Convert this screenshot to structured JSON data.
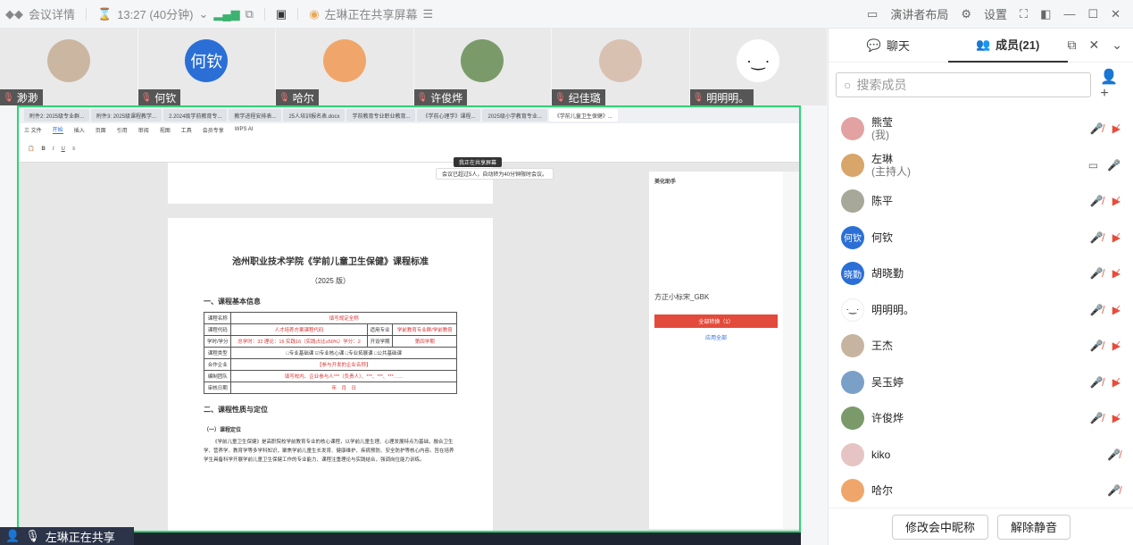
{
  "titlebar": {
    "meeting_details": "会议详情",
    "timer": "13:27 (40分钟)",
    "sharing_status": "左琳正在共享屏幕",
    "layout_label": "演讲者布局",
    "settings_label": "设置"
  },
  "video_tiles": [
    {
      "name": "渺渺",
      "avatar_text": "",
      "color": "#cbb7a1"
    },
    {
      "name": "何钦",
      "avatar_text": "何钦",
      "color": "#2b6fd6"
    },
    {
      "name": "哈尔",
      "avatar_text": "",
      "color": "#f0a66a"
    },
    {
      "name": "许俊烨",
      "avatar_text": "",
      "color": "#7a9a6a"
    },
    {
      "name": "纪佳璐",
      "avatar_text": "",
      "color": "#d9c1b2"
    },
    {
      "name": "明明明。",
      "avatar_text": "·‿·",
      "color": "#ffffff"
    }
  ],
  "shared_screen": {
    "tabs": [
      "附件2: 2025级专业群...",
      "附件3: 2025级课程教学...",
      "2.2024级学前教育专...",
      "教学进程安排表...",
      "25人培训报名表.docx",
      "学前教育专业职业教育...",
      "《学前心理学》课程...",
      "2025级小学教育专业...",
      "《学前儿童卫生保健》..."
    ],
    "menu": [
      "三 文件",
      "开始",
      "插入",
      "页面",
      "引用",
      "审阅",
      "视图",
      "工具",
      "会员专享",
      "WPS AI"
    ],
    "share_tag": "我正在共享屏幕",
    "notice": "会议已超过5人，自动转为40分钟限时会议。",
    "doc_title": "池州职业技术学院《学前儿童卫生保健》课程标准",
    "doc_year": "（2025 版）",
    "section1": "一、课程基本信息",
    "table": [
      [
        "课程名称",
        "填写规定全称"
      ],
      [
        "课程代码",
        "人才培养方案课程代码",
        "适用专业",
        "学前教育专业群/学前教育"
      ],
      [
        "学时/学分",
        "总学时：32 理论：16 实践16（实践占比≥50%）学分：2",
        "开设学期",
        "第四学期"
      ],
      [
        "课程类型",
        "□专业基础课 ☑专业核心课 □专业拓展课 □公共基础课"
      ],
      [
        "合作企业",
        "【参与开发的企业名称】"
      ],
      [
        "编制团队",
        "填写校内、企业参与人***（负责人）、***、***、***……"
      ],
      [
        "审核日期",
        "年　月　日"
      ]
    ],
    "section2": "二、课程性质与定位",
    "sub1": "（一）课程定位",
    "para": "《学前儿童卫生保健》是高职院校学前教育专业的核心课程，以学前儿童生理、心理发展特点为基础，融合卫生学、营养学、教育学等多学科知识，聚焦学前儿童生长发育、健康维护、疾病预防、安全防护等核心内容。旨在培养学生具备科学开展学前儿童卫生保健工作的专业能力、课程注重理论与实践结合，强调岗位能力训练。",
    "side_title": "美化助手",
    "side_button": "全部转换（1）",
    "side_font_label": "方正小标宋_GBK",
    "side_apply_all": "应用全部",
    "taskbar_sharing": "左琳正在共享"
  },
  "panel": {
    "tab_chat": "聊天",
    "tab_members": "成员(21)",
    "search_placeholder": "搜索成员",
    "members": [
      {
        "name": "熊莹",
        "sub": "(我)",
        "avatar_text": "",
        "color": "#e2a2a2",
        "icons": [
          "mic-off",
          "cam-off"
        ]
      },
      {
        "name": "左琳",
        "sub": "(主持人)",
        "avatar_text": "",
        "color": "#d8a56a",
        "icons": [
          "share",
          "mic-on"
        ]
      },
      {
        "name": "陈平",
        "sub": "",
        "avatar_text": "",
        "color": "#a8a89a",
        "icons": [
          "mic-off",
          "cam-off"
        ]
      },
      {
        "name": "何钦",
        "sub": "",
        "avatar_text": "何钦",
        "color": "#2b6fd6",
        "icons": [
          "mic-off",
          "cam-off"
        ]
      },
      {
        "name": "胡晓勤",
        "sub": "",
        "avatar_text": "晓勤",
        "color": "#2b6fd6",
        "icons": [
          "mic-off",
          "cam-off"
        ]
      },
      {
        "name": "明明明。",
        "sub": "",
        "avatar_text": "·‿·",
        "color": "#ffffff",
        "icons": [
          "mic-off",
          "cam-off"
        ]
      },
      {
        "name": "王杰",
        "sub": "",
        "avatar_text": "",
        "color": "#c7b4a0",
        "icons": [
          "mic-off",
          "cam-off"
        ]
      },
      {
        "name": "吴玉婷",
        "sub": "",
        "avatar_text": "",
        "color": "#7aa0c8",
        "icons": [
          "mic-off",
          "cam-off"
        ]
      },
      {
        "name": "许俊烨",
        "sub": "",
        "avatar_text": "",
        "color": "#7a9a6a",
        "icons": [
          "mic-off",
          "cam-off"
        ]
      },
      {
        "name": "kiko",
        "sub": "",
        "avatar_text": "",
        "color": "#e6c4c4",
        "icons": [
          "mic-off"
        ]
      },
      {
        "name": "哈尔",
        "sub": "",
        "avatar_text": "",
        "color": "#f0a66a",
        "icons": [
          "mic-off"
        ]
      }
    ],
    "btn_rename": "修改会中昵称",
    "btn_unmute": "解除静音"
  }
}
